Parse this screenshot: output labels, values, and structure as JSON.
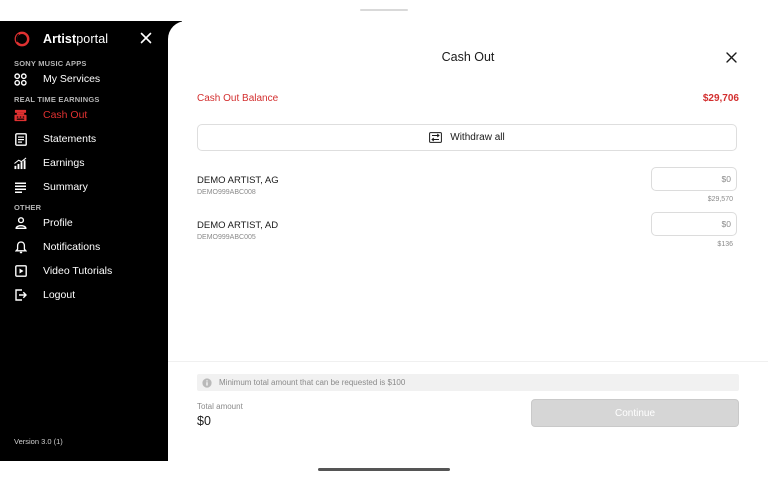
{
  "brand": {
    "name_bold": "Artist",
    "name_regular": "portal",
    "logo_icon": "sony-o-ring-icon",
    "accent": "#e03131"
  },
  "sidebar": {
    "sections": [
      "SONY MUSIC APPS",
      "REAL TIME EARNINGS",
      "OTHER"
    ],
    "items": [
      {
        "label": "My Services",
        "icon": "grid-services-icon"
      },
      {
        "label": "Cash Out",
        "icon": "cash-register-icon",
        "active": true
      },
      {
        "label": "Statements",
        "icon": "document-icon"
      },
      {
        "label": "Earnings",
        "icon": "bar-chart-icon"
      },
      {
        "label": "Summary",
        "icon": "list-summary-icon"
      },
      {
        "label": "Profile",
        "icon": "person-icon"
      },
      {
        "label": "Notifications",
        "icon": "bell-icon"
      },
      {
        "label": "Video Tutorials",
        "icon": "play-video-icon"
      },
      {
        "label": "Logout",
        "icon": "logout-icon"
      }
    ],
    "version": "Version 3.0 (1)"
  },
  "panel": {
    "title": "Cash Out",
    "balance_label": "Cash Out Balance",
    "balance_value": "$29,706",
    "withdraw_label": "Withdraw all",
    "artists": [
      {
        "name": "DEMO ARTIST, AG",
        "code": "DEMO999ABC008",
        "input_placeholder": "$0",
        "available": "$29,570"
      },
      {
        "name": "DEMO ARTIST, AD",
        "code": "DEMO999ABC005",
        "input_placeholder": "$0",
        "available": "$136"
      }
    ]
  },
  "footer": {
    "notice": "Minimum total amount that can be requested is $100",
    "total_label": "Total amount",
    "total_value": "$0",
    "continue_label": "Continue"
  },
  "colors": {
    "balance_red": "#d32f2f",
    "sidebar_bg": "#000000",
    "button_disabled": "#d6d6d6"
  }
}
